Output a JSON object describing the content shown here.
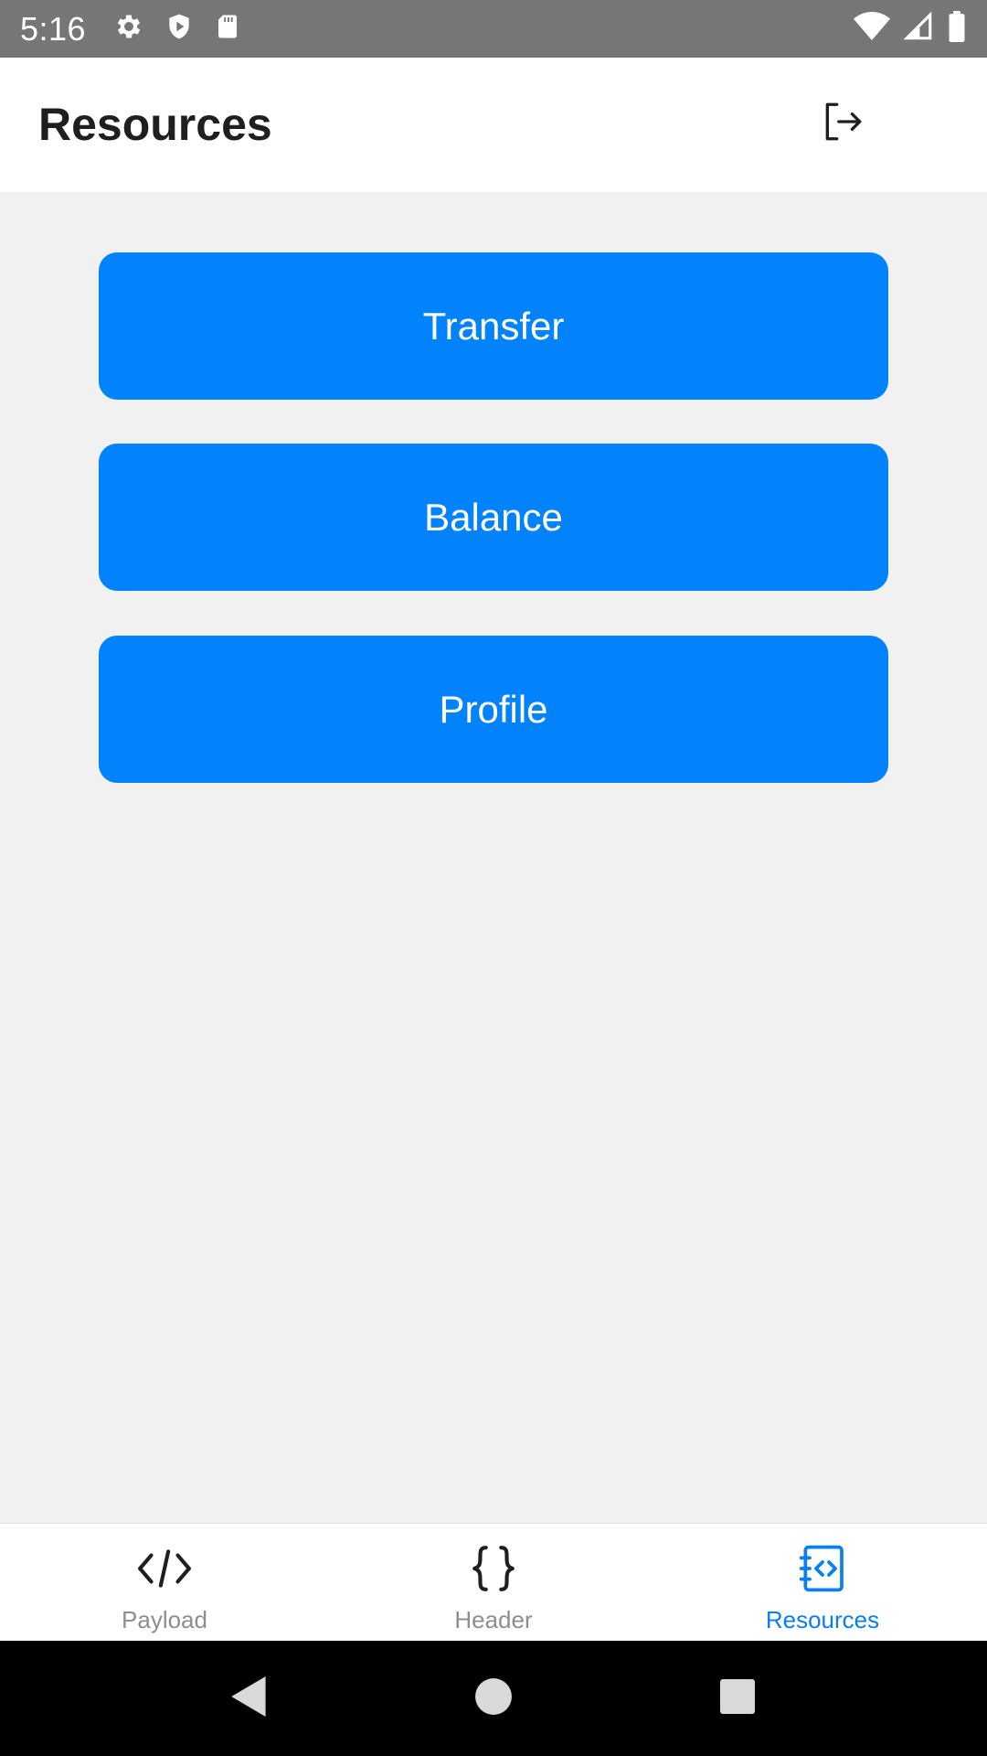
{
  "status_bar": {
    "time": "5:16",
    "left_icons": [
      "gear-icon",
      "shield-icon",
      "sd-card-icon"
    ],
    "right_icons": [
      "wifi-icon",
      "signal-icon",
      "battery-icon"
    ]
  },
  "header": {
    "title": "Resources",
    "logout_icon": "logout-icon"
  },
  "main": {
    "buttons": [
      {
        "label": "Transfer"
      },
      {
        "label": "Balance"
      },
      {
        "label": "Profile"
      }
    ]
  },
  "bottom_nav": {
    "items": [
      {
        "label": "Payload",
        "icon": "code-icon",
        "active": false
      },
      {
        "label": "Header",
        "icon": "braces-icon",
        "active": false
      },
      {
        "label": "Resources",
        "icon": "resource-doc-icon",
        "active": true
      }
    ]
  },
  "system_nav": {
    "buttons": [
      "back-icon",
      "home-icon",
      "recents-icon"
    ]
  },
  "colors": {
    "primary": "#0282fb",
    "active_tab": "#0a7ff0",
    "inactive_tab": "#8e8e8e",
    "status_bar": "#767676",
    "background": "#f1f1f1"
  }
}
